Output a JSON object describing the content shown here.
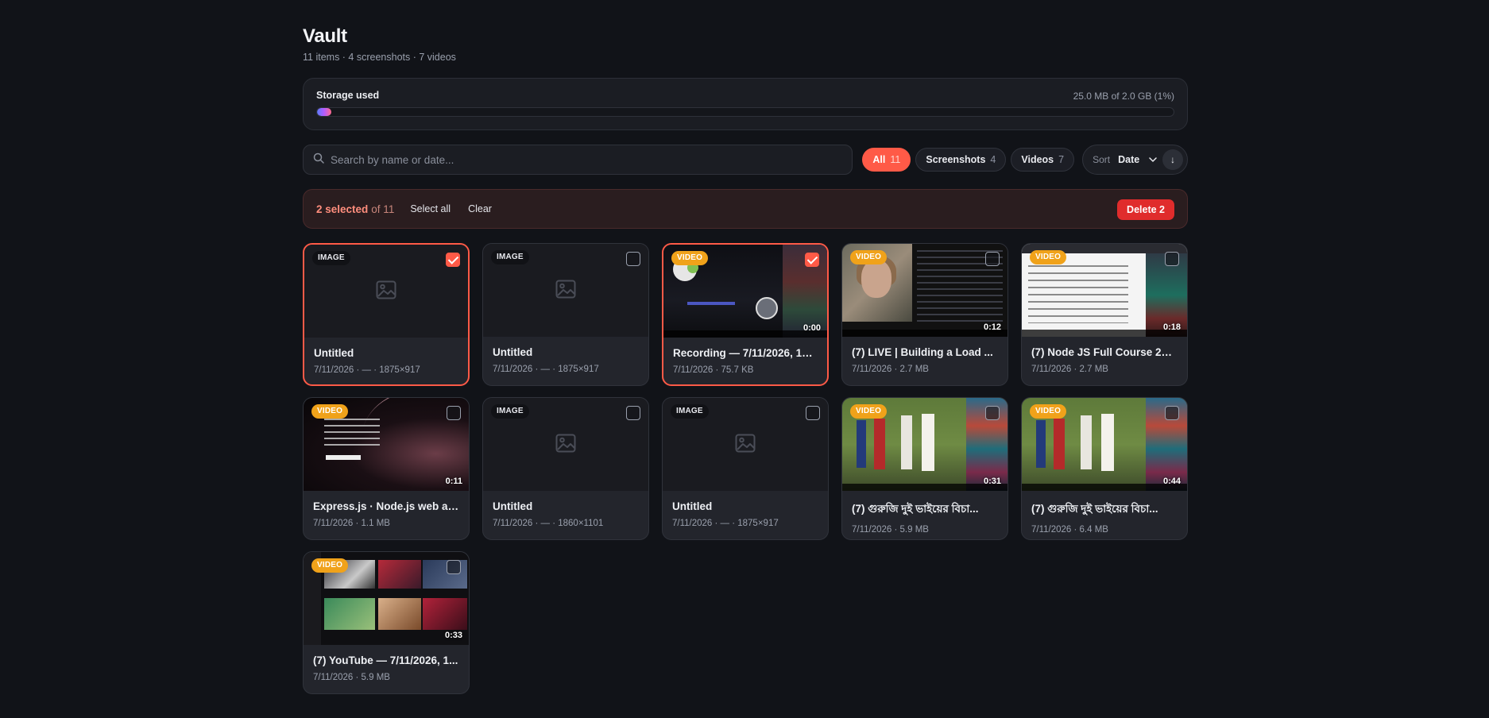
{
  "header": {
    "title": "Vault",
    "subtitle": "11 items · 4 screenshots · 7 videos"
  },
  "storage": {
    "label": "Storage used",
    "value": "25.0 MB of 2.0 GB (1%)",
    "percent": 1
  },
  "search": {
    "placeholder": "Search by name or date..."
  },
  "filters": [
    {
      "label": "All",
      "count": "11",
      "active": true
    },
    {
      "label": "Screenshots",
      "count": "4",
      "active": false
    },
    {
      "label": "Videos",
      "count": "7",
      "active": false
    }
  ],
  "sort": {
    "label": "Sort",
    "value": "Date",
    "direction_icon": "↓"
  },
  "selection": {
    "count": "2 selected",
    "of": "of 11",
    "select_all": "Select all",
    "clear": "Clear",
    "delete": "Delete 2"
  },
  "items": [
    {
      "type": "IMAGE",
      "title": "Untitled",
      "meta": "7/11/2026 · — · 1875×917",
      "selected": true,
      "duration": "",
      "art": ""
    },
    {
      "type": "IMAGE",
      "title": "Untitled",
      "meta": "7/11/2026 · — · 1875×917",
      "selected": false,
      "duration": "",
      "art": ""
    },
    {
      "type": "VIDEO",
      "title": "Recording — 7/11/2026, 12:...",
      "meta": "7/11/2026 · 75.7 KB",
      "selected": true,
      "duration": "0:00",
      "art": "rec"
    },
    {
      "type": "VIDEO",
      "title": "(7) LIVE | Building a Load ...",
      "meta": "7/11/2026 · 2.7 MB",
      "selected": false,
      "duration": "0:12",
      "art": "live"
    },
    {
      "type": "VIDEO",
      "title": "(7) Node JS Full Course 202...",
      "meta": "7/11/2026 · 2.7 MB",
      "selected": false,
      "duration": "0:18",
      "art": "node"
    },
    {
      "type": "VIDEO",
      "title": "Express.js · Node.js web ap...",
      "meta": "7/11/2026 · 1.1 MB",
      "selected": false,
      "duration": "0:11",
      "art": "exp"
    },
    {
      "type": "IMAGE",
      "title": "Untitled",
      "meta": "7/11/2026 · — · 1860×1101",
      "selected": false,
      "duration": "",
      "art": ""
    },
    {
      "type": "IMAGE",
      "title": "Untitled",
      "meta": "7/11/2026 · — · 1875×917",
      "selected": false,
      "duration": "",
      "art": ""
    },
    {
      "type": "VIDEO",
      "title": "(7) গুরুজি দুই ভাইয়ের বিচা...",
      "meta": "7/11/2026 · 5.9 MB",
      "selected": false,
      "duration": "0:31",
      "art": "bn"
    },
    {
      "type": "VIDEO",
      "title": "(7) গুরুজি দুই ভাইয়ের বিচা...",
      "meta": "7/11/2026 · 6.4 MB",
      "selected": false,
      "duration": "0:44",
      "art": "bn"
    },
    {
      "type": "VIDEO",
      "title": "(7) YouTube — 7/11/2026, 1...",
      "meta": "7/11/2026 · 5.9 MB",
      "selected": false,
      "duration": "0:33",
      "art": "yt"
    }
  ],
  "colors": {
    "accent": "#ff5a47",
    "video_badge": "#f0a21a",
    "delete": "#e02c2c",
    "background": "#111318"
  },
  "icons": {
    "search": "search-icon",
    "sort_chevron": "chevron-down-icon",
    "image_placeholder": "image-icon"
  }
}
